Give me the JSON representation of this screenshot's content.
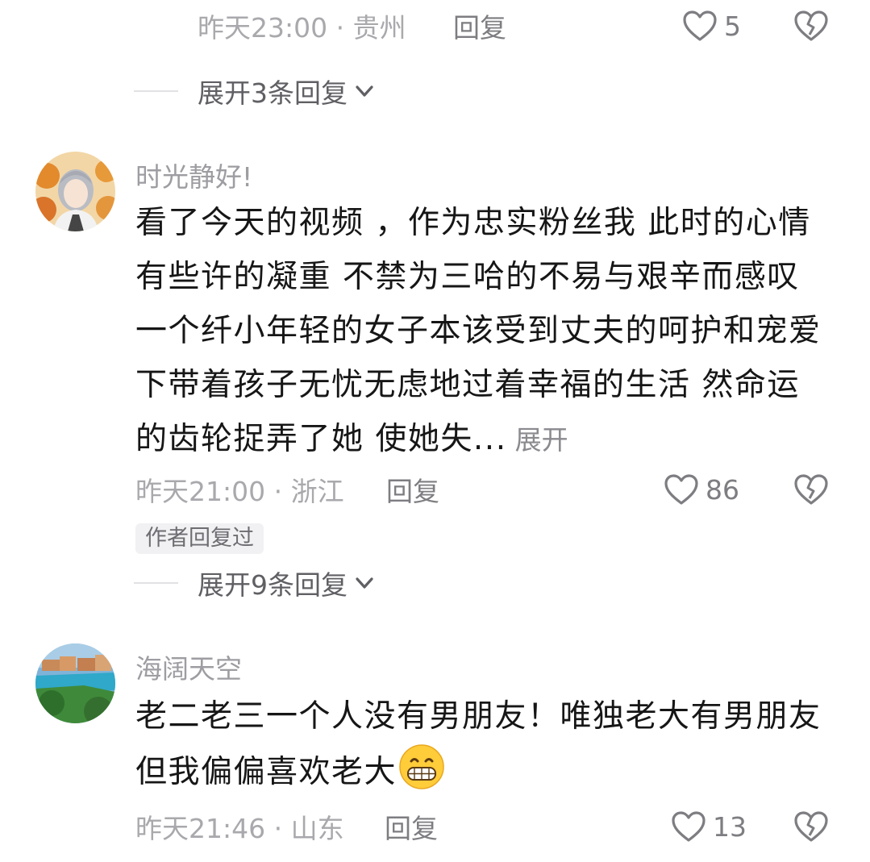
{
  "top_comment": {
    "time_location": "昨天23:00 · 贵州",
    "reply_label": "回复",
    "like_count": "5",
    "expand_label": "展开3条回复"
  },
  "comments": [
    {
      "username": "时光静好!",
      "content_lines": [
        "看了今天的视频 ，作为忠实粉丝我 此时的心情",
        "有些许的凝重  不禁为三哈的不易与艰辛而感叹",
        "一个纤小年轻的女子本该受到丈夫的呵护和宠爱",
        "下带着孩子无忧无虑地过着幸福的生活  然命运",
        "的齿轮捉弄了她  使她失..."
      ],
      "more_label": "展开",
      "time_location": "昨天21:00 · 浙江",
      "reply_label": "回复",
      "like_count": "86",
      "author_badge": "作者回复过",
      "expand_label": "展开9条回复"
    },
    {
      "username": "海阔天空",
      "content_lines": [
        "老二老三一个人没有男朋友！唯独老大有男朋友",
        "但我偏偏喜欢老大"
      ],
      "emoji": "grinning-face-emoji",
      "time_location": "昨天21:46 · 山东",
      "reply_label": "回复",
      "like_count": "13"
    }
  ],
  "icons": {
    "like": "heart-outline-icon",
    "dislike": "broken-heart-outline-icon",
    "expand": "chevron-down-icon"
  },
  "colors": {
    "meta_text": "#a9a9ad",
    "content_text": "#161616",
    "badge_bg": "#f1f1f3"
  }
}
